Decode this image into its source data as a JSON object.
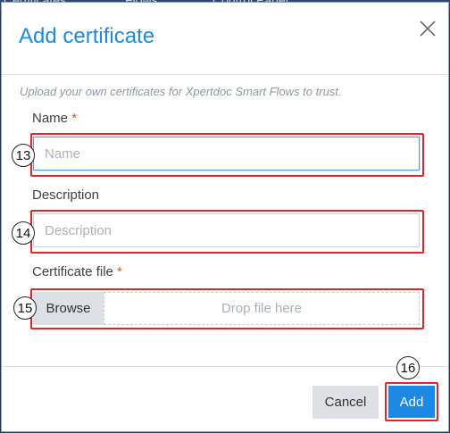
{
  "background": {
    "tabs": [
      "Certificates",
      "Flows",
      "Control Panel"
    ]
  },
  "dialog": {
    "title": "Add certificate",
    "intro": "Upload your own certificates for Xpertdoc Smart Flows to trust.",
    "name": {
      "label": "Name",
      "required_mark": "*",
      "value": "",
      "placeholder": "Name"
    },
    "description": {
      "label": "Description",
      "value": "",
      "placeholder": "Description"
    },
    "certificate_file": {
      "label": "Certificate file",
      "required_mark": "*",
      "browse_label": "Browse",
      "drop_text": "Drop file here"
    },
    "footer": {
      "cancel_label": "Cancel",
      "add_label": "Add"
    }
  },
  "annotations": {
    "name_field": "13",
    "description_field": "14",
    "file_field": "15",
    "add_button": "16"
  },
  "colors": {
    "accent": "#1e88e5",
    "title": "#1f8ad7",
    "required": "#e2501e",
    "highlight": "#e0262a"
  },
  "icons": {
    "close": "close-icon"
  }
}
